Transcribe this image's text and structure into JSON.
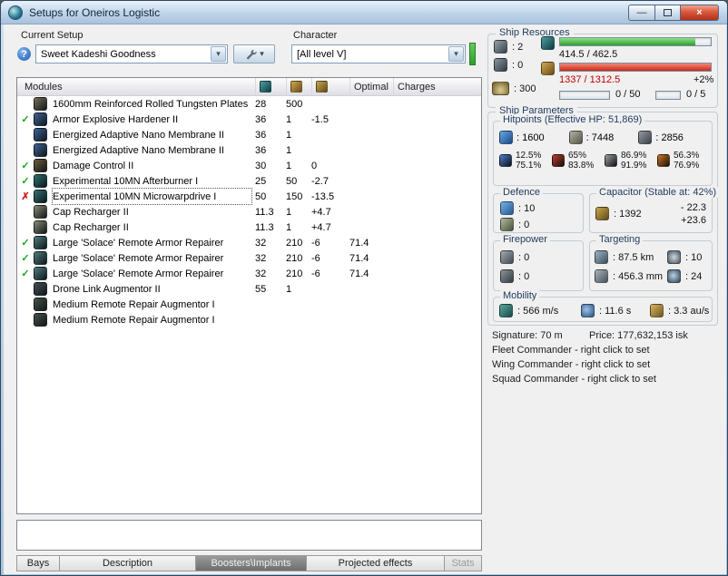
{
  "icons": {
    "check": "✓",
    "cross": "✗",
    "dropdown": "▾",
    "help": "?",
    "close": "×",
    "minimize": "—"
  },
  "window": {
    "title": "Setups for Oneiros Logistic"
  },
  "setup": {
    "label": "Current Setup",
    "value": "Sweet Kadeshi Goodness",
    "character_label": "Character",
    "character_value": "[All level V]"
  },
  "resources": {
    "title": "Ship Resources",
    "turrets": ": 2",
    "launchers": ": 0",
    "calibration": ": 300",
    "cpu_text": "414.5 / 462.5",
    "cpu_pct": 90,
    "pg_text": "1337 / 1312.5",
    "pg_pct": 100,
    "pg_extra": "+2%",
    "drone_text": "0 / 50",
    "rig_text": "0 / 5"
  },
  "modules": {
    "header_label": "Modules",
    "optimal_label": "Optimal",
    "charges_label": "Charges",
    "rows": [
      {
        "status": "",
        "icon": "#7a6f57",
        "name": "1600mm Reinforced Rolled Tungsten Plates I",
        "cpu": "28",
        "pg": "500",
        "cap": "",
        "optimal": "",
        "charges": "",
        "selected": false
      },
      {
        "status": "check",
        "icon": "#3f6396",
        "name": "Armor Explosive Hardener II",
        "cpu": "36",
        "pg": "1",
        "cap": "-1.5",
        "optimal": "",
        "charges": "",
        "selected": false
      },
      {
        "status": "",
        "icon": "#3f6396",
        "name": "Energized Adaptive Nano Membrane II",
        "cpu": "36",
        "pg": "1",
        "cap": "",
        "optimal": "",
        "charges": "",
        "selected": false
      },
      {
        "status": "",
        "icon": "#3f6396",
        "name": "Energized Adaptive Nano Membrane II",
        "cpu": "36",
        "pg": "1",
        "cap": "",
        "optimal": "",
        "charges": "",
        "selected": false
      },
      {
        "status": "check",
        "icon": "#6e5b38",
        "name": "Damage Control II",
        "cpu": "30",
        "pg": "1",
        "cap": "0",
        "optimal": "",
        "charges": "",
        "selected": false
      },
      {
        "status": "check",
        "icon": "#2f7272",
        "name": "Experimental 10MN Afterburner I",
        "cpu": "25",
        "pg": "50",
        "cap": "-2.7",
        "optimal": "",
        "charges": "",
        "selected": false
      },
      {
        "status": "cross",
        "icon": "#2f7272",
        "name": "Experimental 10MN Microwarpdrive I",
        "cpu": "50",
        "pg": "150",
        "cap": "-13.5",
        "optimal": "",
        "charges": "",
        "selected": true
      },
      {
        "status": "",
        "icon": "#8a8a74",
        "name": "Cap Recharger II",
        "cpu": "11.3",
        "pg": "1",
        "cap": "+4.7",
        "optimal": "",
        "charges": "",
        "selected": false
      },
      {
        "status": "",
        "icon": "#8a8a74",
        "name": "Cap Recharger II",
        "cpu": "11.3",
        "pg": "1",
        "cap": "+4.7",
        "optimal": "",
        "charges": "",
        "selected": false
      },
      {
        "status": "check",
        "icon": "#4e7d7d",
        "name": "Large 'Solace' Remote Armor Repairer",
        "cpu": "32",
        "pg": "210",
        "cap": "-6",
        "optimal": "71.4",
        "charges": "",
        "selected": false
      },
      {
        "status": "check",
        "icon": "#4e7d7d",
        "name": "Large 'Solace' Remote Armor Repairer",
        "cpu": "32",
        "pg": "210",
        "cap": "-6",
        "optimal": "71.4",
        "charges": "",
        "selected": false
      },
      {
        "status": "check",
        "icon": "#4e7d7d",
        "name": "Large 'Solace' Remote Armor Repairer",
        "cpu": "32",
        "pg": "210",
        "cap": "-6",
        "optimal": "71.4",
        "charges": "",
        "selected": false
      },
      {
        "status": "",
        "icon": "#474f55",
        "name": "Drone Link Augmentor II",
        "cpu": "55",
        "pg": "1",
        "cap": "",
        "optimal": "",
        "charges": "",
        "selected": false
      },
      {
        "status": "",
        "icon": "#4a5248",
        "name": "Medium Remote Repair Augmentor I",
        "cpu": "",
        "pg": "",
        "cap": "",
        "optimal": "",
        "charges": "",
        "selected": false
      },
      {
        "status": "",
        "icon": "#4a5248",
        "name": "Medium Remote Repair Augmentor I",
        "cpu": "",
        "pg": "",
        "cap": "",
        "optimal": "",
        "charges": "",
        "selected": false
      }
    ]
  },
  "params": {
    "title": "Ship Parameters",
    "hitpoints": {
      "title": "Hitpoints (Effective HP: 51,869)",
      "shield": ": 1600",
      "armor": ": 7448",
      "hull": ": 2856",
      "resists": [
        {
          "name": "em",
          "color": "#4a7fd4",
          "top": "12.5%",
          "bottom": "75.1%"
        },
        {
          "name": "thermal",
          "color": "#c23b2e",
          "top": "65%",
          "bottom": "83.8%"
        },
        {
          "name": "kinetic",
          "color": "#9aa2aa",
          "top": "86.9%",
          "bottom": "91.9%"
        },
        {
          "name": "explosive",
          "color": "#d2741e",
          "top": "56.3%",
          "bottom": "76.9%"
        }
      ]
    },
    "defence": {
      "title": "Defence",
      "row1": ": 10",
      "row2": ": 0"
    },
    "capacitor": {
      "title": "Capacitor (Stable at: 42%)",
      "amount": ": 1392",
      "drain": "- 22.3",
      "recharge": "+23.6"
    },
    "firepower": {
      "title": "Firepower",
      "volley": ": 0",
      "dps": ": 0"
    },
    "targeting": {
      "title": "Targeting",
      "range": ": 87.5 km",
      "max_targets": ": 10",
      "scan_res": ": 456.3 mm",
      "sensor": ": 24"
    },
    "mobility": {
      "title": "Mobility",
      "speed": ": 566 m/s",
      "align": ": 11.6 s",
      "warp": ": 3.3 au/s"
    },
    "signature": "Signature: 70 m",
    "price": "Price: 177,632,153 isk",
    "fleet": "Fleet Commander - right click to set",
    "wing": "Wing Commander - right click to set",
    "squad": "Squad Commander - right click to set"
  },
  "tabs": [
    {
      "label": "Bays",
      "state": "normal"
    },
    {
      "label": "Description",
      "state": "normal"
    },
    {
      "label": "Boosters\\Implants",
      "state": "active"
    },
    {
      "label": "Projected effects",
      "state": "normal"
    },
    {
      "label": "Stats",
      "state": "disabled"
    }
  ]
}
